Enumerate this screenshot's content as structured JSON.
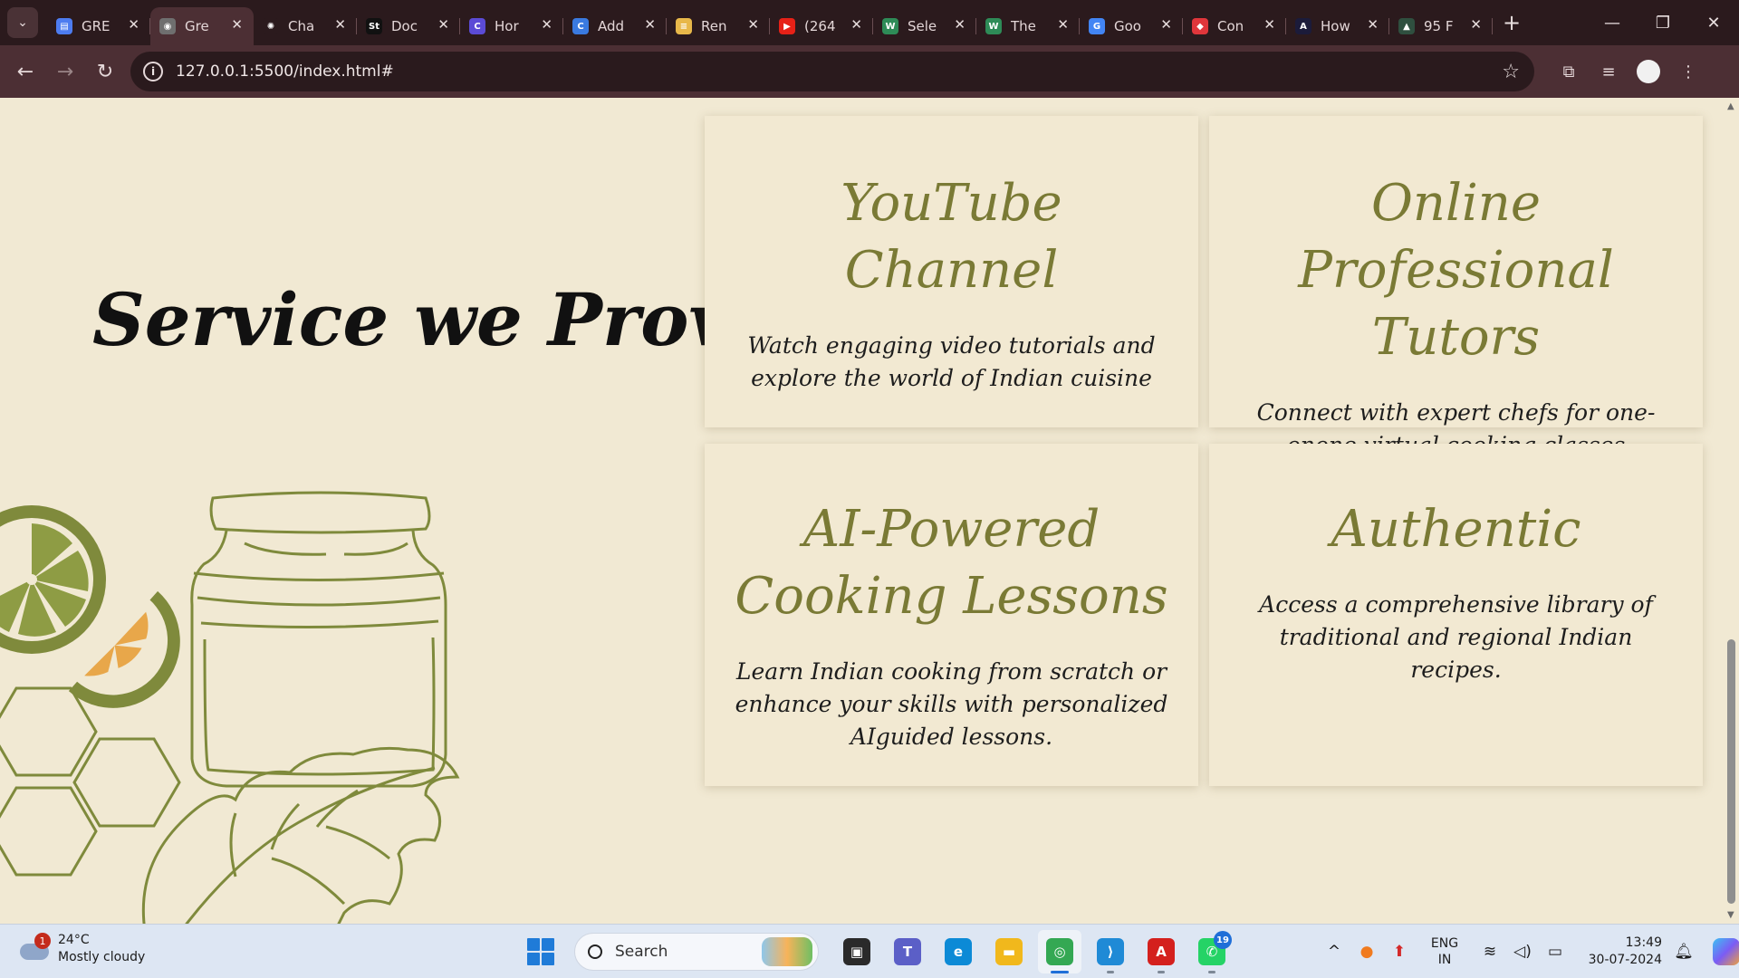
{
  "browser": {
    "tabs": [
      {
        "title": "GRE",
        "favicon_color": "#4d7cf0",
        "favicon_glyph": "▤"
      },
      {
        "title": "Gre",
        "favicon_color": "#6f6f6f",
        "favicon_glyph": "◉",
        "active": true
      },
      {
        "title": "Cha",
        "favicon_color": "#2b1a1d",
        "favicon_glyph": "✺"
      },
      {
        "title": "Doc",
        "favicon_color": "#111111",
        "favicon_glyph": "St"
      },
      {
        "title": "Hor",
        "favicon_color": "#5b4bd6",
        "favicon_glyph": "C"
      },
      {
        "title": "Add",
        "favicon_color": "#3a7ae0",
        "favicon_glyph": "C"
      },
      {
        "title": "Ren",
        "favicon_color": "#e8b84a",
        "favicon_glyph": "≡"
      },
      {
        "title": "(264",
        "favicon_color": "#e62117",
        "favicon_glyph": "▶"
      },
      {
        "title": "Sele",
        "favicon_color": "#2e8b57",
        "favicon_glyph": "W"
      },
      {
        "title": "The",
        "favicon_color": "#2e8b57",
        "favicon_glyph": "W"
      },
      {
        "title": "Goo",
        "favicon_color": "#4285f4",
        "favicon_glyph": "G"
      },
      {
        "title": "Con",
        "favicon_color": "#e0363b",
        "favicon_glyph": "◆"
      },
      {
        "title": "How",
        "favicon_color": "#1b1b3a",
        "favicon_glyph": "A"
      },
      {
        "title": "95 F",
        "favicon_color": "#2f4f3f",
        "favicon_glyph": "▲"
      }
    ],
    "url": "127.0.0.1:5500/index.html#",
    "icons": {
      "back": "←",
      "forward": "→",
      "reload": "↻",
      "star": "☆",
      "extensions": "⧉",
      "media": "≡",
      "menu": "⋮",
      "minimize": "—",
      "restore": "❐",
      "close": "✕",
      "new_tab": "+",
      "tab_search": "⌄",
      "tab_close": "✕"
    }
  },
  "page": {
    "heading": "Service we Provide",
    "services": [
      {
        "title": "YouTube Channel",
        "description": "Watch engaging video tutorials and explore the world of Indian cuisine"
      },
      {
        "title": "Online Professional Tutors",
        "description": "Connect with expert chefs for one-onone virtual cooking classes"
      },
      {
        "title": "AI-Powered Cooking Lessons",
        "description": "Learn Indian cooking from scratch or enhance your skills with personalized AIguided lessons."
      },
      {
        "title": "Authentic",
        "description": "Access a comprehensive library of traditional and regional Indian recipes."
      }
    ],
    "colors": {
      "background": "#f1e9d3",
      "accent": "#7a7a35",
      "text": "#1d1d1d"
    }
  },
  "taskbar": {
    "weather": {
      "temp": "24°C",
      "condition": "Mostly cloudy",
      "badge": "1"
    },
    "search_placeholder": "Search",
    "apps": [
      {
        "name": "task-view",
        "glyph": "▣",
        "color": "#2a2a2a"
      },
      {
        "name": "teams",
        "glyph": "T",
        "color": "#5b5fc7"
      },
      {
        "name": "edge",
        "glyph": "e",
        "color": "#0c8ad6"
      },
      {
        "name": "file-explorer",
        "glyph": "▬",
        "color": "#f1b81c"
      },
      {
        "name": "chrome",
        "glyph": "◎",
        "color": "#34a853",
        "active": true
      },
      {
        "name": "vscode",
        "glyph": "⟩",
        "color": "#1f8ad6"
      },
      {
        "name": "acrobat",
        "glyph": "A",
        "color": "#d4201d"
      },
      {
        "name": "whatsapp",
        "glyph": "✆",
        "color": "#25d366",
        "count": "19"
      }
    ],
    "tray": {
      "chevron": "^",
      "lang_top": "ENG",
      "lang_bottom": "IN",
      "time": "13:49",
      "date": "30-07-2024"
    }
  }
}
